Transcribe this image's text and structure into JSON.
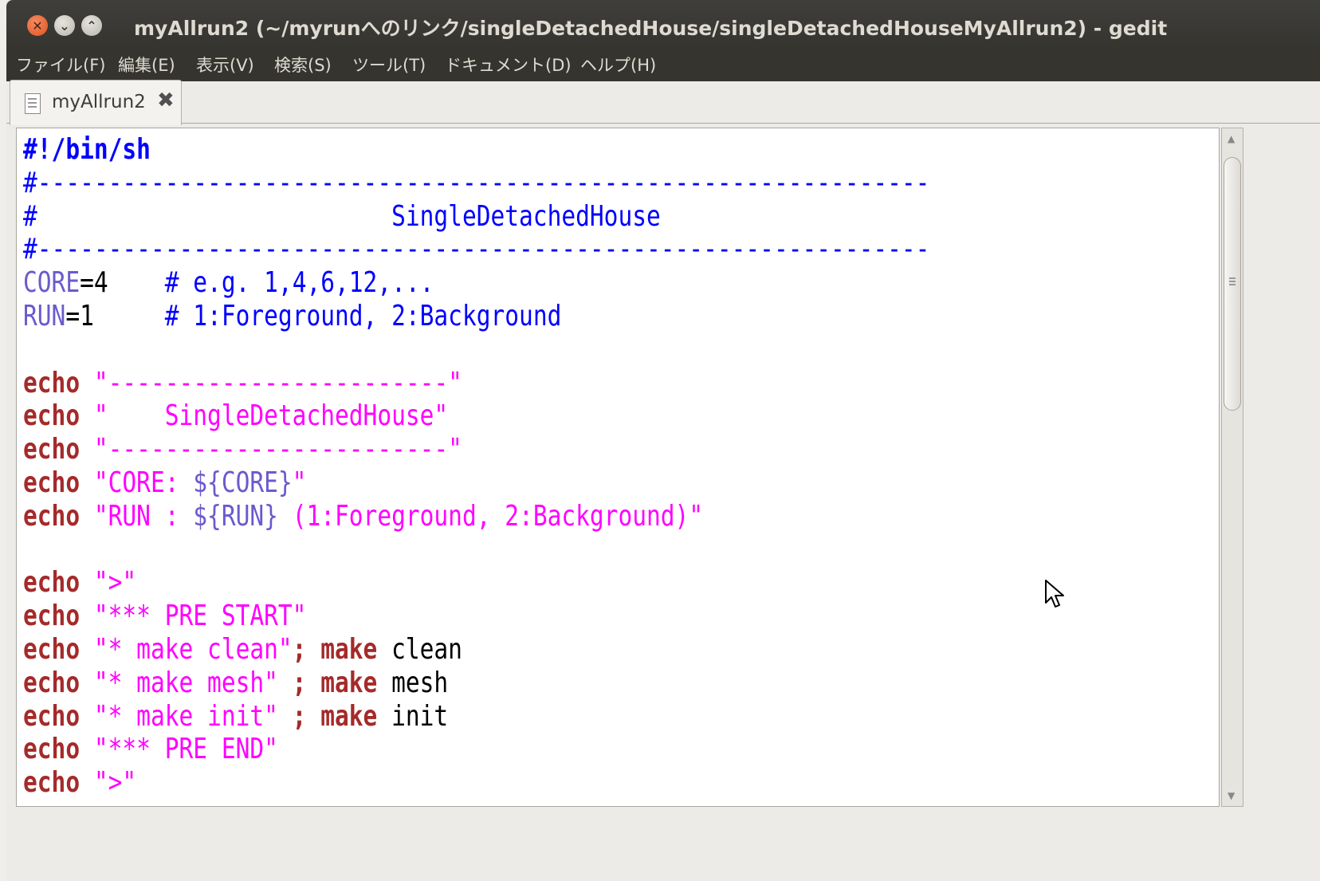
{
  "window": {
    "title": "myAllrun2 (~/myrunへのリンク/singleDetachedHouse/singleDetachedHouseMyAllrun2) - gedit"
  },
  "menu": [
    {
      "label": "ファイル(F)"
    },
    {
      "label": "編集(E)"
    },
    {
      "label": "表示(V)"
    },
    {
      "label": "検索(S)"
    },
    {
      "label": "ツール(T)"
    },
    {
      "label": "ドキュメント(D)"
    },
    {
      "label": "ヘルプ(H)"
    }
  ],
  "tab": {
    "label": "myAllrun2",
    "icon": "text-document-icon",
    "close_icon": "close-icon"
  },
  "editor": {
    "lines": [
      [
        {
          "t": "#!/bin/sh",
          "c": "shebang"
        }
      ],
      [
        {
          "t": "#---------------------------------------------------------------",
          "c": "cmt"
        }
      ],
      [
        {
          "t": "#                         SingleDetachedHouse",
          "c": "cmt"
        }
      ],
      [
        {
          "t": "#---------------------------------------------------------------",
          "c": "cmt"
        }
      ],
      [
        {
          "t": "CORE",
          "c": "var"
        },
        {
          "t": "=4    ",
          "c": "plain"
        },
        {
          "t": "# e.g. 1,4,6,12,...",
          "c": "cmt"
        }
      ],
      [
        {
          "t": "RUN",
          "c": "var"
        },
        {
          "t": "=1     ",
          "c": "plain"
        },
        {
          "t": "# 1:Foreground, 2:Background",
          "c": "cmt"
        }
      ],
      [],
      [
        {
          "t": "echo ",
          "c": "kw"
        },
        {
          "t": "\"------------------------\"",
          "c": "str"
        }
      ],
      [
        {
          "t": "echo ",
          "c": "kw"
        },
        {
          "t": "\"    SingleDetachedHouse\"",
          "c": "str"
        }
      ],
      [
        {
          "t": "echo ",
          "c": "kw"
        },
        {
          "t": "\"------------------------\"",
          "c": "str"
        }
      ],
      [
        {
          "t": "echo ",
          "c": "kw"
        },
        {
          "t": "\"CORE: ",
          "c": "str"
        },
        {
          "t": "${CORE}",
          "c": "var"
        },
        {
          "t": "\"",
          "c": "str"
        }
      ],
      [
        {
          "t": "echo ",
          "c": "kw"
        },
        {
          "t": "\"RUN : ",
          "c": "str"
        },
        {
          "t": "${RUN}",
          "c": "var"
        },
        {
          "t": " (1:Foreground, 2:Background)\"",
          "c": "str"
        }
      ],
      [],
      [
        {
          "t": "echo ",
          "c": "kw"
        },
        {
          "t": "\">\"",
          "c": "str"
        }
      ],
      [
        {
          "t": "echo ",
          "c": "kw"
        },
        {
          "t": "\"*** PRE START\"",
          "c": "str"
        }
      ],
      [
        {
          "t": "echo ",
          "c": "kw"
        },
        {
          "t": "\"* make clean\"",
          "c": "str"
        },
        {
          "t": "; make ",
          "c": "kw"
        },
        {
          "t": "clean",
          "c": "plain"
        }
      ],
      [
        {
          "t": "echo ",
          "c": "kw"
        },
        {
          "t": "\"* make mesh\" ",
          "c": "str"
        },
        {
          "t": "; make ",
          "c": "kw"
        },
        {
          "t": "mesh",
          "c": "plain"
        }
      ],
      [
        {
          "t": "echo ",
          "c": "kw"
        },
        {
          "t": "\"* make init\" ",
          "c": "str"
        },
        {
          "t": "; make ",
          "c": "kw"
        },
        {
          "t": "init",
          "c": "plain"
        }
      ],
      [
        {
          "t": "echo ",
          "c": "kw"
        },
        {
          "t": "\"*** PRE END\"",
          "c": "str"
        }
      ],
      [
        {
          "t": "echo ",
          "c": "kw"
        },
        {
          "t": "\">\"",
          "c": "str"
        }
      ]
    ]
  }
}
